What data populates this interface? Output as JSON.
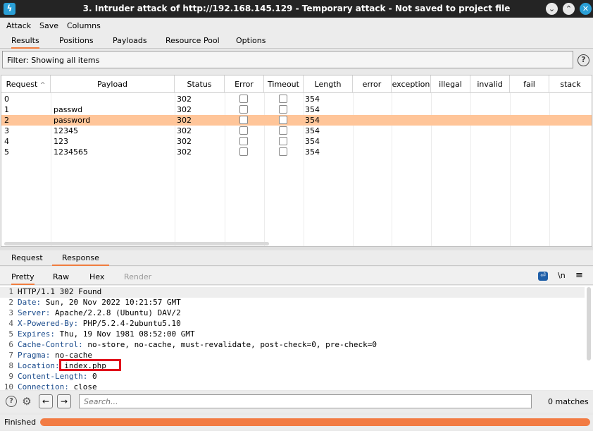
{
  "window": {
    "title": "3. Intruder attack of http://192.168.145.129 - Temporary attack - Not saved to project file",
    "logo_glyph": "ϟ",
    "buttons": {
      "minimize": "⌄",
      "maximize": "⌃",
      "close": "✕"
    }
  },
  "menu": [
    "Attack",
    "Save",
    "Columns"
  ],
  "tabs": [
    "Results",
    "Positions",
    "Payloads",
    "Resource Pool",
    "Options"
  ],
  "filter": {
    "text": "Filter: Showing all items",
    "help": "?"
  },
  "table": {
    "columns": [
      "Request",
      "Payload",
      "Status",
      "Error",
      "Timeout",
      "Length",
      "error",
      "exception",
      "illegal",
      "invalid",
      "fail",
      "stack"
    ],
    "sort_indicator": "^",
    "rows": [
      {
        "request": "0",
        "payload": "",
        "status": "302",
        "length": "354",
        "selected": false
      },
      {
        "request": "1",
        "payload": "passwd",
        "status": "302",
        "length": "354",
        "selected": false
      },
      {
        "request": "2",
        "payload": "password",
        "status": "302",
        "length": "354",
        "selected": true
      },
      {
        "request": "3",
        "payload": "12345",
        "status": "302",
        "length": "354",
        "selected": false
      },
      {
        "request": "4",
        "payload": "123",
        "status": "302",
        "length": "354",
        "selected": false
      },
      {
        "request": "5",
        "payload": "1234565",
        "status": "302",
        "length": "354",
        "selected": false
      }
    ],
    "selected_color": "#ffc599"
  },
  "req_resp_tabs": [
    "Request",
    "Response"
  ],
  "view_tabs": [
    "Pretty",
    "Raw",
    "Hex",
    "Render"
  ],
  "view_icons": {
    "newline": "\\n",
    "menu": "≡",
    "wrap": "⏎"
  },
  "response_lines": [
    {
      "n": "1",
      "key": "HTTP/1.1 302 Found",
      "val": ""
    },
    {
      "n": "2",
      "key": "Date:",
      "val": " Sun, 20 Nov 2022 10:21:57 GMT"
    },
    {
      "n": "3",
      "key": "Server:",
      "val": " Apache/2.2.8 (Ubuntu) DAV/2"
    },
    {
      "n": "4",
      "key": "X-Powered-By:",
      "val": " PHP/5.2.4-2ubuntu5.10"
    },
    {
      "n": "5",
      "key": "Expires:",
      "val": " Thu, 19 Nov 1981 08:52:00 GMT"
    },
    {
      "n": "6",
      "key": "Cache-Control:",
      "val": " no-store, no-cache, must-revalidate, post-check=0, pre-check=0"
    },
    {
      "n": "7",
      "key": "Pragma:",
      "val": " no-cache"
    },
    {
      "n": "8",
      "key": "Location:",
      "val": " index.php"
    },
    {
      "n": "9",
      "key": "Content-Length:",
      "val": " 0"
    },
    {
      "n": "10",
      "key": "Connection:",
      "val": " close"
    }
  ],
  "search": {
    "placeholder": "Search...",
    "matches": "0 matches",
    "help": "?",
    "settings": "⚙",
    "prev": "←",
    "next": "→"
  },
  "status": {
    "text": "Finished",
    "progress_fraction": 1.0,
    "progress_color": "#f27b43"
  },
  "colors": {
    "accent": "#f07d3f",
    "header_key": "#1a4b8c",
    "highlight_box": "#e0101a"
  }
}
